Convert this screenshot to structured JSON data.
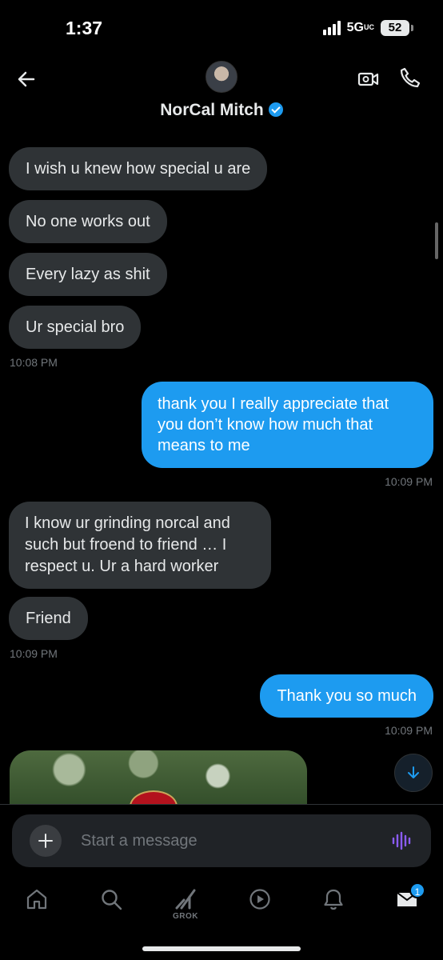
{
  "status_bar": {
    "time": "1:37",
    "network": "5G",
    "network_suffix": "UC",
    "battery": "52"
  },
  "header": {
    "contact_name": "NorCal Mitch",
    "verified": true
  },
  "messages": [
    {
      "direction": "incoming",
      "text": "I wish u knew how special u are"
    },
    {
      "direction": "incoming",
      "text": "No one works out"
    },
    {
      "direction": "incoming",
      "text": "Every lazy as shit"
    },
    {
      "direction": "incoming",
      "text": "Ur special bro"
    },
    {
      "direction": "incoming",
      "timestamp": "10:08 PM"
    },
    {
      "direction": "outgoing",
      "text": "thank you I really appreciate that you don’t know how much that means to me"
    },
    {
      "direction": "outgoing",
      "timestamp": "10:09 PM"
    },
    {
      "direction": "incoming",
      "text": "I know ur grinding norcal and such but froend to friend … I respect u. Ur a hard worker"
    },
    {
      "direction": "incoming",
      "text": "Friend"
    },
    {
      "direction": "incoming",
      "timestamp": "10:09 PM"
    },
    {
      "direction": "outgoing",
      "text": "Thank you so much"
    },
    {
      "direction": "outgoing",
      "timestamp": "10:09 PM"
    }
  ],
  "composer": {
    "placeholder": "Start a message"
  },
  "tabbar": {
    "grok_label": "GROK",
    "messages_badge": "1"
  },
  "colors": {
    "accent": "#1d9bf0",
    "incoming_bubble": "#2f3336",
    "background": "#000000",
    "muted_text": "#71767b",
    "voice_icon": "#8b5cf6"
  },
  "icons": [
    "back-arrow-icon",
    "video-call-icon",
    "phone-icon",
    "plus-icon",
    "voice-icon",
    "home-icon",
    "search-icon",
    "grok-icon",
    "play-icon",
    "bell-icon",
    "mail-icon",
    "arrow-down-icon"
  ]
}
